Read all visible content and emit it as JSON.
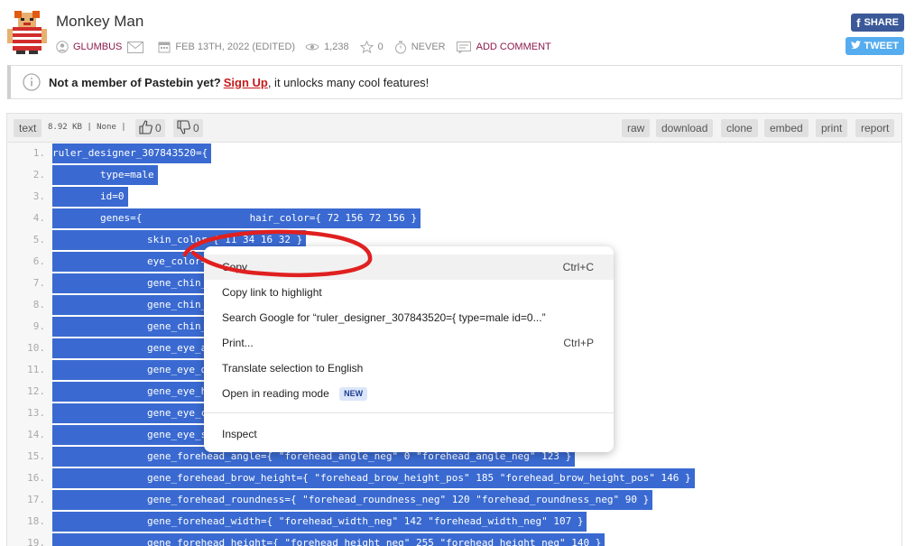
{
  "header": {
    "title": "Monkey Man",
    "author": "GLUMBUS",
    "date": "FEB 13TH, 2022 (EDITED)",
    "views": "1,238",
    "stars": "0",
    "expiry": "NEVER",
    "add_comment": "ADD COMMENT"
  },
  "social": {
    "share": "SHARE",
    "tweet": "TWEET"
  },
  "notice": {
    "bold_text": "Not a member of Pastebin yet?",
    "signup": "Sign Up",
    "rest": ", it unlocks many cool features!"
  },
  "paste_bar": {
    "syntax": "text",
    "size": "8.92 KB | None |",
    "upvotes": "0",
    "downvotes": "0",
    "buttons": [
      "raw",
      "download",
      "clone",
      "embed",
      "print",
      "report"
    ]
  },
  "code": {
    "lines": [
      {
        "n": "1.",
        "text": "ruler_designer_307843520={"
      },
      {
        "n": "2.",
        "text": "type=male"
      },
      {
        "n": "3.",
        "text": "id=0"
      },
      {
        "n": "4.",
        "text": "genes={                  hair_color={ 72 156 72 156 }"
      },
      {
        "n": "5.",
        "text": "skin_color={ 11 34 16 32 }"
      },
      {
        "n": "6.",
        "text": "eye_color={"
      },
      {
        "n": "7.",
        "text": "gene_chin_"
      },
      {
        "n": "8.",
        "text": "gene_chin_"
      },
      {
        "n": "9.",
        "text": "gene_chin_"
      },
      {
        "n": "10.",
        "text": "gene_eye_a"
      },
      {
        "n": "11.",
        "text": "gene_eye_d"
      },
      {
        "n": "12.",
        "text": "gene_eye_h"
      },
      {
        "n": "13.",
        "text": "gene_eye_c"
      },
      {
        "n": "14.",
        "text": "gene_eye_s"
      },
      {
        "n": "15.",
        "text": "gene_forehead_angle={ \"forehead_angle_neg\" 0 \"forehead_angle_neg\" 123 }"
      },
      {
        "n": "16.",
        "text": "gene_forehead_brow_height={ \"forehead_brow_height_pos\" 185 \"forehead_brow_height_pos\" 146 }"
      },
      {
        "n": "17.",
        "text": "gene_forehead_roundness={ \"forehead_roundness_neg\" 120 \"forehead_roundness_neg\" 90 }"
      },
      {
        "n": "18.",
        "text": "gene_forehead_width={ \"forehead_width_neg\" 142 \"forehead_width_neg\" 107 }"
      },
      {
        "n": "19.",
        "text": "gene_forehead_height={ \"forehead_height_neg\" 255 \"forehead_height_neg\" 140 }"
      }
    ]
  },
  "context_menu": {
    "items": [
      {
        "label": "Copy",
        "shortcut": "Ctrl+C"
      },
      {
        "label": "Copy link to highlight",
        "shortcut": ""
      },
      {
        "label": "Search Google for “ruler_designer_307843520={  type=male  id=0...”",
        "shortcut": ""
      },
      {
        "label": "Print...",
        "shortcut": "Ctrl+P"
      },
      {
        "label": "Translate selection to English",
        "shortcut": ""
      },
      {
        "label": "Open in reading mode",
        "shortcut": "",
        "badge": "NEW"
      },
      {
        "label": "Inspect",
        "shortcut": ""
      }
    ]
  },
  "colors": {
    "selection": "#3a6ad1",
    "brand_link": "#8b1a4c",
    "facebook": "#3b5998",
    "twitter": "#55acee",
    "annotation": "#e02020"
  },
  "icons": [
    "user-icon",
    "mail-icon",
    "calendar-icon",
    "eye-icon",
    "star-icon",
    "timer-icon",
    "comment-icon",
    "info-icon",
    "thumbs-up-icon",
    "thumbs-down-icon",
    "facebook-icon",
    "twitter-icon"
  ]
}
